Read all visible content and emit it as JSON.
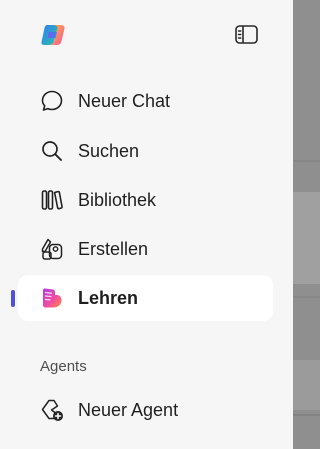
{
  "sidebar": {
    "items": [
      {
        "label": "Neuer Chat",
        "icon": "chat-bubble-icon"
      },
      {
        "label": "Suchen",
        "icon": "search-icon"
      },
      {
        "label": "Bibliothek",
        "icon": "library-icon"
      },
      {
        "label": "Erstellen",
        "icon": "create-icon"
      },
      {
        "label": "Lehren",
        "icon": "teach-icon",
        "active": true
      }
    ],
    "agents": {
      "heading": "Agents",
      "new_agent_label": "Neuer Agent",
      "new_agent_icon": "new-agent-icon"
    },
    "logo_icon": "copilot-logo-icon",
    "collapse_icon": "sidebar-toggle-icon"
  },
  "colors": {
    "accent": "#4f52d6",
    "active_item_bg": "#ffffff",
    "sidebar_bg": "#f6f6f6"
  }
}
